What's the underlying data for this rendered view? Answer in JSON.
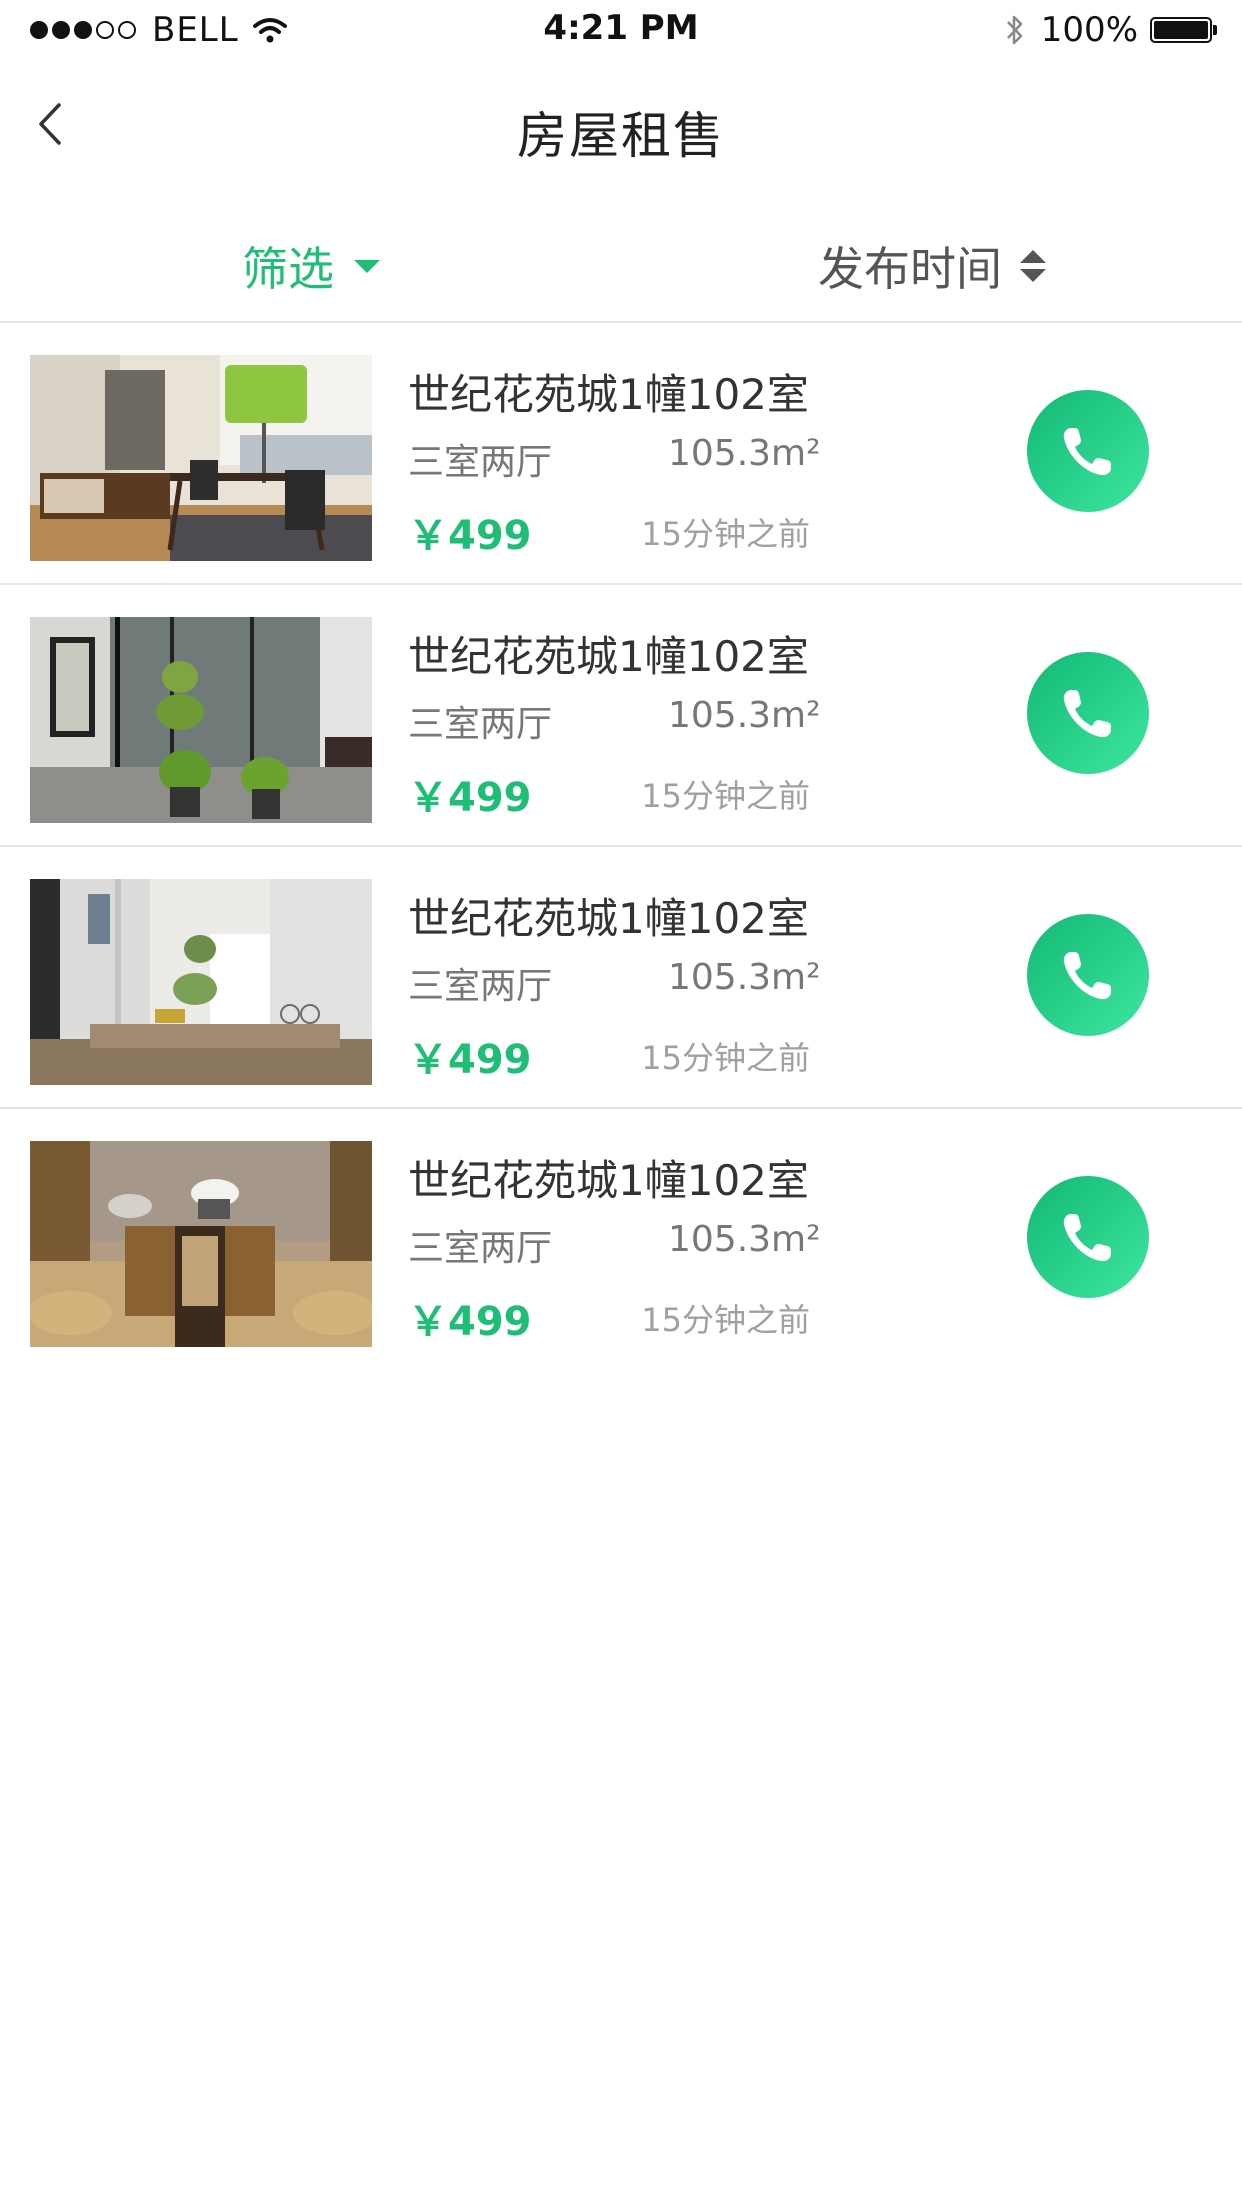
{
  "status_bar": {
    "carrier": "BELL",
    "time": "4:21 PM",
    "battery": "100%"
  },
  "nav": {
    "title": "房屋租售"
  },
  "filter_bar": {
    "filter_label": "筛选",
    "sort_label": "发布时间"
  },
  "colors": {
    "accent": "#1fbe77",
    "call_gradient_start": "#12b873",
    "call_gradient_end": "#3ee6a0"
  },
  "listings": [
    {
      "title": "世纪花苑城1幢102室",
      "layout": "三室两厅",
      "area": "105.3m²",
      "price": "￥499",
      "posted": "15分钟之前",
      "image": "living-dining-room-photo"
    },
    {
      "title": "世纪花苑城1幢102室",
      "layout": "三室两厅",
      "area": "105.3m²",
      "price": "￥499",
      "posted": "15分钟之前",
      "image": "glass-courtyard-bonsai-photo"
    },
    {
      "title": "世纪花苑城1幢102室",
      "layout": "三室两厅",
      "area": "105.3m²",
      "price": "￥499",
      "posted": "15分钟之前",
      "image": "white-hallway-photo"
    },
    {
      "title": "世纪花苑城1幢102室",
      "layout": "三室两厅",
      "area": "105.3m²",
      "price": "￥499",
      "posted": "15分钟之前",
      "image": "tea-room-photo"
    }
  ]
}
